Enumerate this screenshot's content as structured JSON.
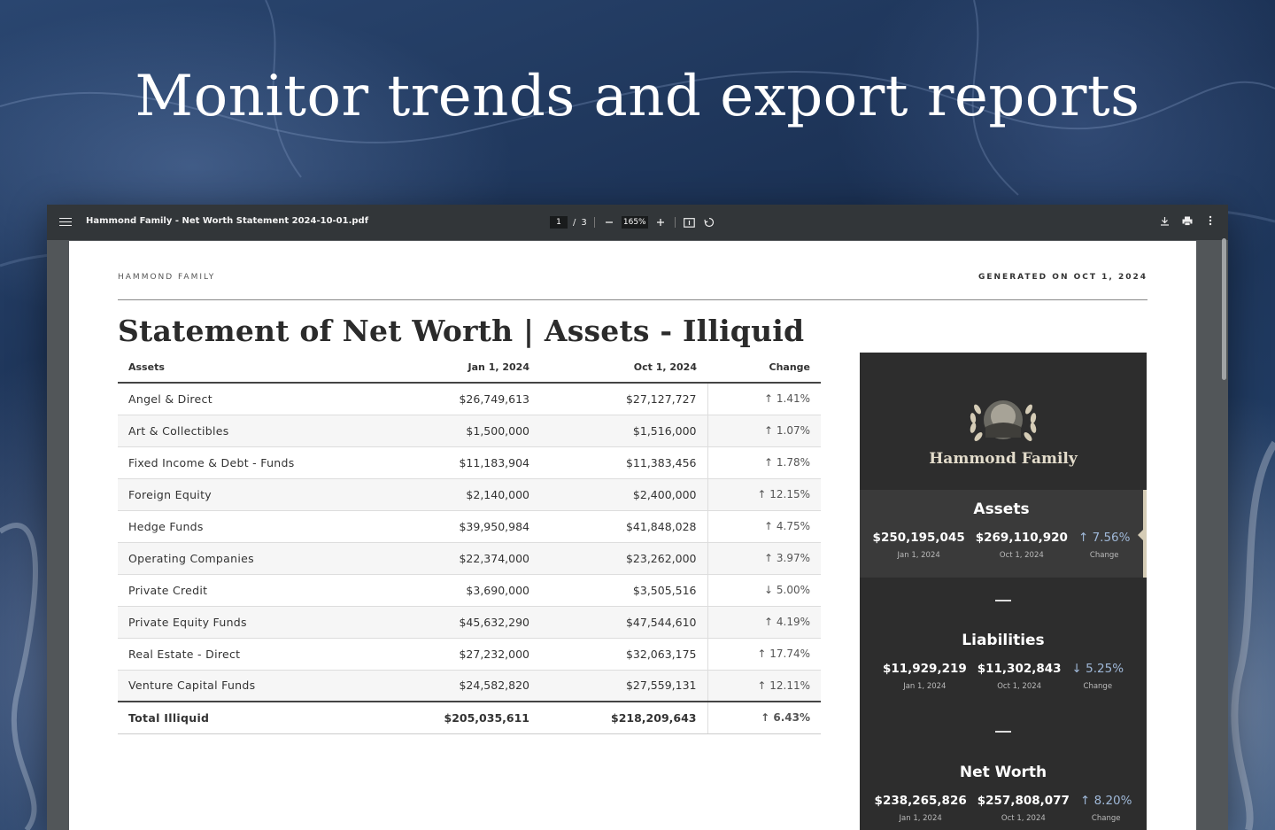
{
  "hero": {
    "title": "Monitor trends and export reports"
  },
  "toolbar": {
    "filename": "Hammond Family - Net Worth Statement 2024-10-01.pdf",
    "current_page": "1",
    "page_sep": "/",
    "total_pages": "3",
    "zoom": "165%",
    "icons": [
      "menu-icon",
      "zoom-out-icon",
      "zoom-in-icon",
      "fit-page-icon",
      "rotate-icon",
      "download-icon",
      "print-icon",
      "more-icon"
    ]
  },
  "document": {
    "org": "HAMMOND FAMILY",
    "generated": "GENERATED ON OCT 1, 2024",
    "title": "Statement of Net Worth | Assets - Illiquid",
    "table": {
      "headers": [
        "Assets",
        "Jan 1, 2024",
        "Oct 1, 2024",
        "Change"
      ],
      "rows": [
        {
          "name": "Angel & Direct",
          "jan": "$26,749,613",
          "oct": "$27,127,727",
          "dir": "↑",
          "change": "1.41%"
        },
        {
          "name": "Art & Collectibles",
          "jan": "$1,500,000",
          "oct": "$1,516,000",
          "dir": "↑",
          "change": "1.07%"
        },
        {
          "name": "Fixed Income & Debt - Funds",
          "jan": "$11,183,904",
          "oct": "$11,383,456",
          "dir": "↑",
          "change": "1.78%"
        },
        {
          "name": "Foreign Equity",
          "jan": "$2,140,000",
          "oct": "$2,400,000",
          "dir": "↑",
          "change": "12.15%"
        },
        {
          "name": "Hedge Funds",
          "jan": "$39,950,984",
          "oct": "$41,848,028",
          "dir": "↑",
          "change": "4.75%"
        },
        {
          "name": "Operating Companies",
          "jan": "$22,374,000",
          "oct": "$23,262,000",
          "dir": "↑",
          "change": "3.97%"
        },
        {
          "name": "Private Credit",
          "jan": "$3,690,000",
          "oct": "$3,505,516",
          "dir": "↓",
          "change": "5.00%"
        },
        {
          "name": "Private Equity Funds",
          "jan": "$45,632,290",
          "oct": "$47,544,610",
          "dir": "↑",
          "change": "4.19%"
        },
        {
          "name": "Real Estate - Direct",
          "jan": "$27,232,000",
          "oct": "$32,063,175",
          "dir": "↑",
          "change": "17.74%"
        },
        {
          "name": "Venture Capital Funds",
          "jan": "$24,582,820",
          "oct": "$27,559,131",
          "dir": "↑",
          "change": "12.11%"
        }
      ],
      "total": {
        "name": "Total Illiquid",
        "jan": "$205,035,611",
        "oct": "$218,209,643",
        "dir": "↑",
        "change": "6.43%"
      }
    }
  },
  "summary": {
    "family_name": "Hammond Family",
    "colors": {
      "panel": "#2d2d2d",
      "accent": "#d5ccb6",
      "change": "#9fb8d8"
    },
    "sections": [
      {
        "title": "Assets",
        "jan": "$250,195,045",
        "oct": "$269,110,920",
        "dir": "↑",
        "change": "7.56%",
        "jan_label": "Jan 1, 2024",
        "oct_label": "Oct 1, 2024",
        "change_label": "Change"
      },
      {
        "title": "Liabilities",
        "jan": "$11,929,219",
        "oct": "$11,302,843",
        "dir": "↓",
        "change": "5.25%",
        "jan_label": "Jan 1, 2024",
        "oct_label": "Oct 1, 2024",
        "change_label": "Change"
      },
      {
        "title": "Net Worth",
        "jan": "$238,265,826",
        "oct": "$257,808,077",
        "dir": "↑",
        "change": "8.20%",
        "jan_label": "Jan 1, 2024",
        "oct_label": "Oct 1, 2024",
        "change_label": "Change"
      }
    ]
  }
}
